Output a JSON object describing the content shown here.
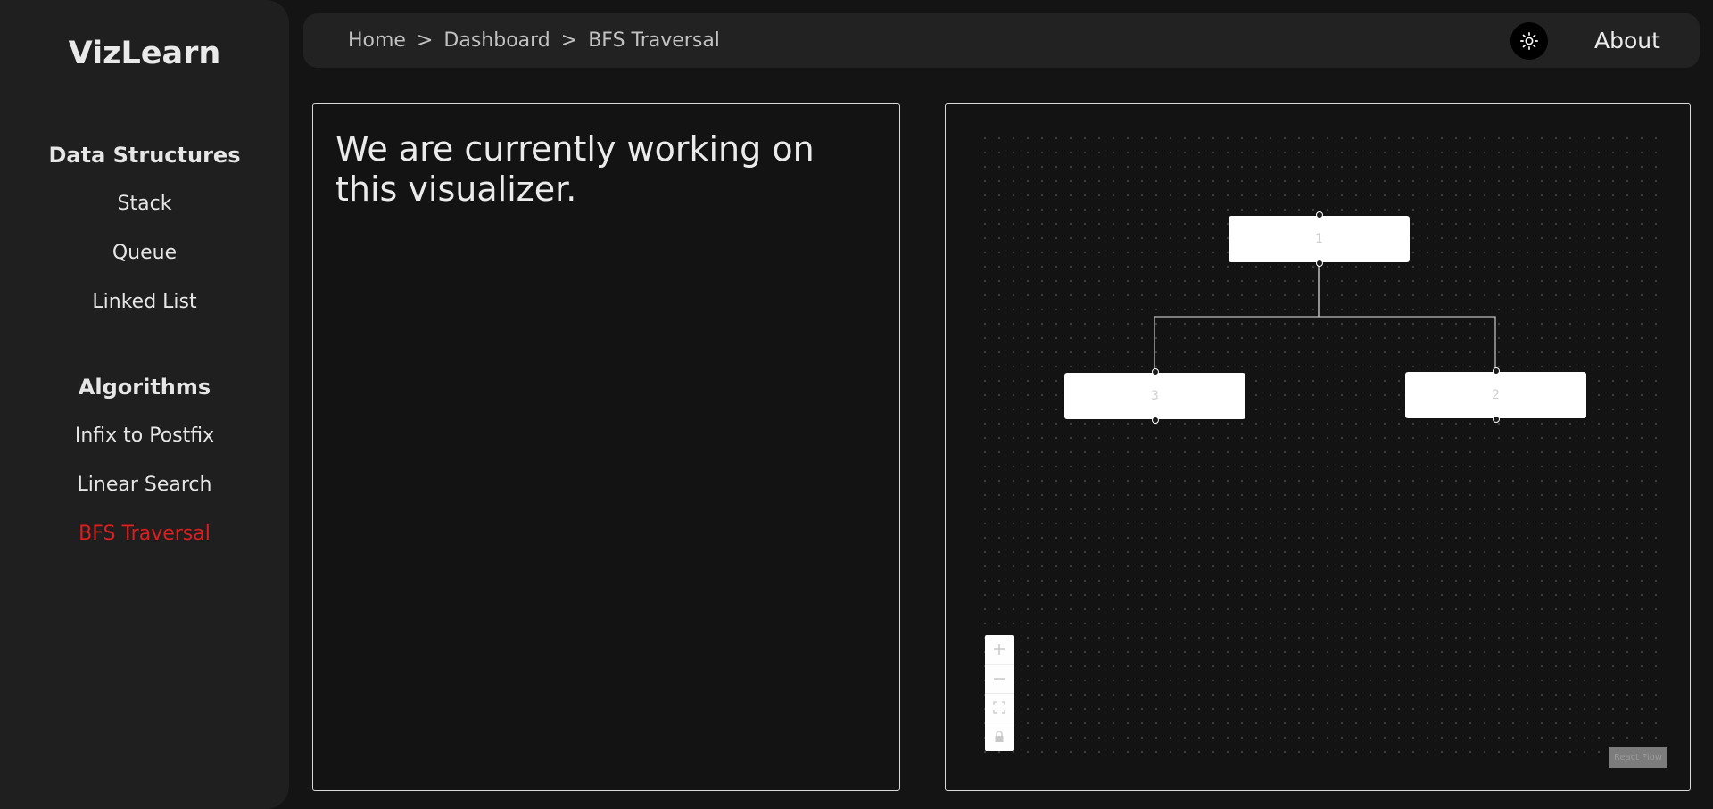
{
  "brand": "VizLearn",
  "sidebar": {
    "sections": [
      {
        "heading": "Data Structures",
        "items": [
          "Stack",
          "Queue",
          "Linked List"
        ]
      },
      {
        "heading": "Algorithms",
        "items": [
          "Infix to Postfix",
          "Linear Search",
          "BFS Traversal"
        ]
      }
    ],
    "active_item": "BFS Traversal"
  },
  "colors": {
    "accent_active": "#d91f1f",
    "background": "#141414",
    "sidebar": "#1f1f1f",
    "topbar": "#222222",
    "node_fill": "#ffffff"
  },
  "header": {
    "breadcrumb": [
      "Home",
      "Dashboard",
      "BFS Traversal"
    ],
    "separator": ">",
    "theme_toggle_icon": "sun-icon",
    "about_label": "About"
  },
  "left_panel": {
    "message": "We are currently working on this visualizer."
  },
  "graph": {
    "nodes": [
      {
        "id": "n1",
        "label": "1"
      },
      {
        "id": "n3",
        "label": "3"
      },
      {
        "id": "n2",
        "label": "2"
      }
    ],
    "edges": [
      {
        "from": "1",
        "to": "3"
      },
      {
        "from": "1",
        "to": "2"
      }
    ],
    "controls": [
      "plus-icon",
      "minus-icon",
      "fit-view-icon",
      "lock-icon"
    ],
    "attribution": "React Flow"
  }
}
